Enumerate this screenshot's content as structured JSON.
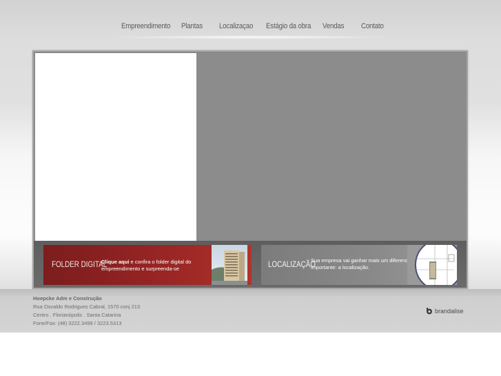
{
  "nav": {
    "items": [
      {
        "label": "Empreendimento"
      },
      {
        "label": "Plantas"
      },
      {
        "label": "Localizaçao"
      },
      {
        "label": "Estágio da obra"
      },
      {
        "label": "Vendas"
      },
      {
        "label": "Contato"
      }
    ]
  },
  "banners": {
    "folder": {
      "title": "FOLDER DIGITAL",
      "link": "Clique aqui",
      "text": " e confira o folder digital do empreendimento  e surpreenda-se"
    },
    "localizacao": {
      "title": "LOCALIZAÇÃO",
      "text": "Sua empresa vai ganhar mais um diferencial importante: a localização."
    }
  },
  "footer": {
    "company": "Hoepcke Adm e Construção",
    "address": "Rua Osvaldo Rodrigues Cabral, 1570 conj 213",
    "city": "Centro . Florianópolis . Santa Catarina",
    "phone": "Fone/Fax: (48) 3222.3499 / 3223.5313"
  },
  "brand": {
    "name": "brandalise",
    "icon": "brandalise-logo-icon"
  },
  "colors": {
    "folder_banner": "#8f2222",
    "local_banner": "#8a8a8a",
    "frame": "#8a8a8a"
  }
}
